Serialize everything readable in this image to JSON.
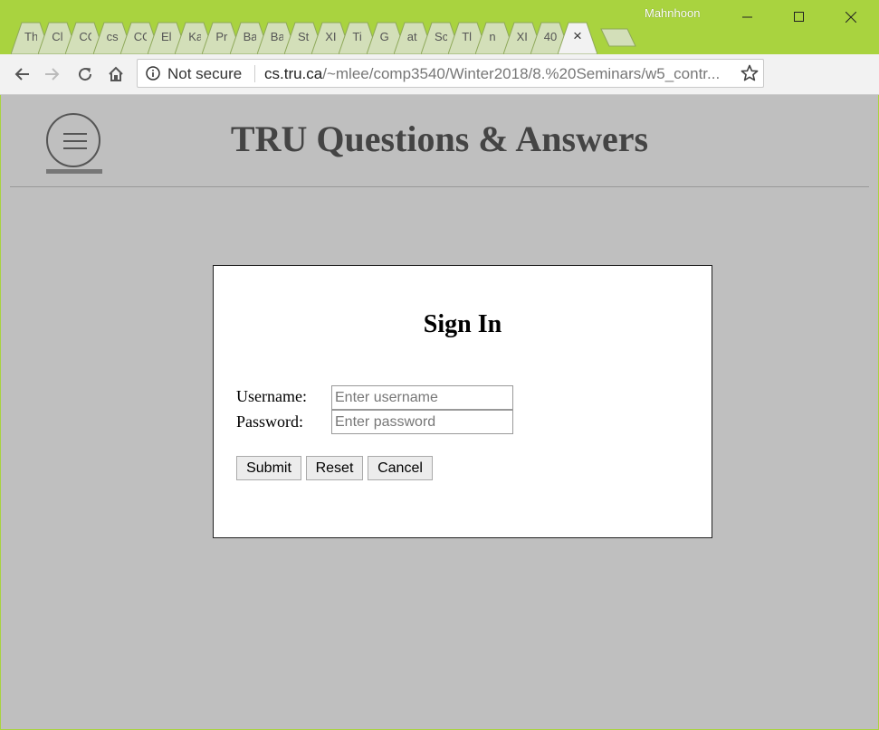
{
  "browser": {
    "profile_name": "Mahnhoon",
    "tabs": [
      "Th",
      "Cl",
      "CO",
      "cs",
      "CO",
      "El",
      "Ka",
      "Pr",
      "Ba",
      "Ba",
      "St",
      "XI",
      "Ti",
      "G",
      "at",
      "Sc",
      "Tl",
      "n",
      "XI",
      "40"
    ],
    "active_tab_close": "×",
    "omnibox": {
      "security_label": "Not secure",
      "url_host": "cs.tru.ca",
      "url_path": "/~mlee/comp3540/Winter2018/8.%20Seminars/w5_contr..."
    }
  },
  "site": {
    "title": "TRU Questions & Answers"
  },
  "signin": {
    "heading": "Sign In",
    "username_label": "Username:",
    "username_placeholder": "Enter username",
    "password_label": "Password:",
    "password_placeholder": "Enter password",
    "submit_label": "Submit",
    "reset_label": "Reset",
    "cancel_label": "Cancel"
  },
  "colors": {
    "frame": "#a9d33f",
    "page_background": "#bfbfbf",
    "dialog_background": "#ffffff"
  }
}
